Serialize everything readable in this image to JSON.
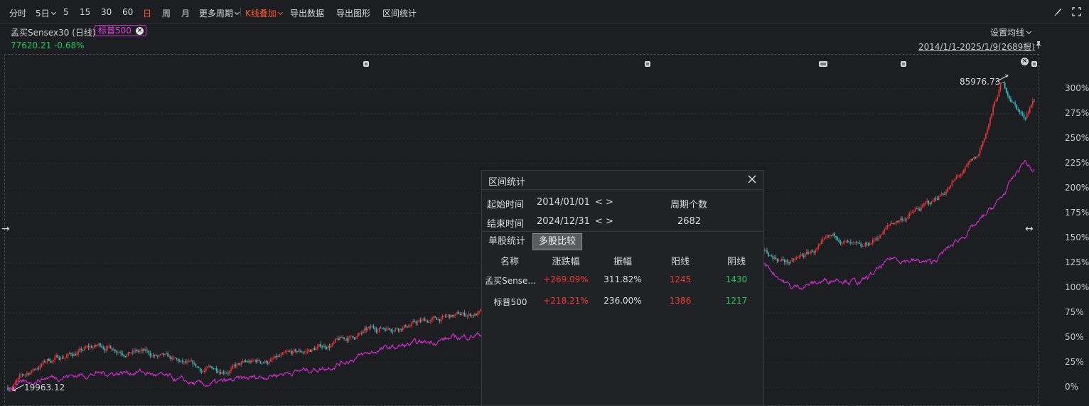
{
  "toolbar": {
    "items": [
      "分时",
      "5日",
      "5",
      "15",
      "30",
      "60",
      "日",
      "周",
      "月",
      "更多周期",
      "K线叠加",
      "导出数据",
      "导出图形",
      "区间统计"
    ],
    "active_period": "日"
  },
  "instrument": {
    "name": "孟买Sensex30 (日线)",
    "compare_tag": "标普500",
    "price_text": "77620.21 -0.68%",
    "ma_setting": "设置均线",
    "date_range": "2014/1/1-2025/1/9(2689根)"
  },
  "chart": {
    "y_ticks": [
      "300%",
      "275%",
      "250%",
      "225%",
      "200%",
      "175%",
      "150%",
      "125%",
      "100%",
      "75%",
      "50%",
      "25%",
      "0%"
    ],
    "high_label": "85976.73",
    "low_label": "19963.12",
    "colors": {
      "up": "#f03a3a",
      "down": "#36c6c8",
      "compare": "#d22fd2",
      "background": "#1d1e22"
    }
  },
  "chart_data": {
    "type": "line",
    "y_unit": "%",
    "ylim": [
      0,
      310
    ],
    "x_range": [
      "2014/1/1",
      "2025/1/9"
    ],
    "series": [
      {
        "name": "孟买Sensex30",
        "x": [
          "2014-01",
          "2014-06",
          "2015-01",
          "2015-06",
          "2016-02",
          "2017-01",
          "2017-06",
          "2018-01",
          "2018-09",
          "2019-06",
          "2020-01",
          "2020-03",
          "2020-06",
          "2020-11",
          "2021-03",
          "2021-10",
          "2022-06",
          "2022-12",
          "2023-03",
          "2023-07",
          "2023-12",
          "2024-06",
          "2024-09",
          "2024-12",
          "2025-01"
        ],
        "values": [
          0,
          27,
          42,
          36,
          16,
          30,
          42,
          60,
          69,
          80,
          82,
          54,
          70,
          88,
          100,
          145,
          125,
          150,
          135,
          165,
          185,
          230,
          305,
          270,
          289
        ]
      },
      {
        "name": "标普500",
        "x": [
          "2014-01",
          "2014-06",
          "2015-01",
          "2015-06",
          "2016-02",
          "2017-01",
          "2017-06",
          "2018-01",
          "2018-09",
          "2019-06",
          "2020-01",
          "2020-03",
          "2020-06",
          "2020-11",
          "2021-03",
          "2021-10",
          "2022-06",
          "2022-12",
          "2023-03",
          "2023-07",
          "2023-12",
          "2024-06",
          "2024-09",
          "2024-12",
          "2025-01"
        ],
        "values": [
          0,
          10,
          14,
          16,
          2,
          15,
          20,
          38,
          48,
          58,
          66,
          27,
          55,
          75,
          95,
          155,
          100,
          110,
          105,
          130,
          125,
          165,
          190,
          228,
          218
        ]
      }
    ]
  },
  "dialog": {
    "title": "区间统计",
    "start_label": "起始时间",
    "start_value": "2014/01/01",
    "end_label": "结束时间",
    "end_value": "2024/12/31",
    "nav": "< >",
    "period_label": "周期个数",
    "period_value": "2682",
    "tabs": [
      "单股统计",
      "多股比较"
    ],
    "columns": [
      "名称",
      "涨跌幅",
      "振幅",
      "阳线",
      "阴线"
    ],
    "rows": [
      {
        "name": "孟买Sense...",
        "change": "+269.09%",
        "amplitude": "311.82%",
        "up": "1245",
        "down": "1430"
      },
      {
        "name": "标普500",
        "change": "+218.21%",
        "amplitude": "236.00%",
        "up": "1386",
        "down": "1217"
      }
    ]
  }
}
